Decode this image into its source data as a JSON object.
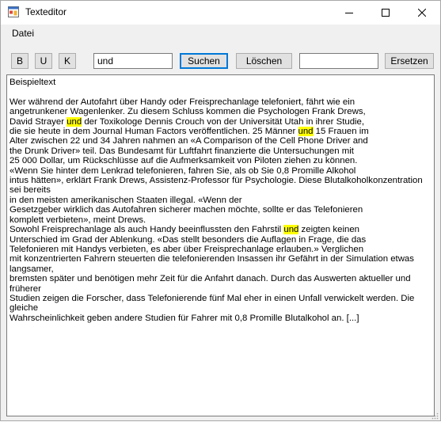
{
  "window": {
    "title": "Texteditor",
    "icons": {
      "app": "window-app-icon",
      "minimize": "minimize-icon",
      "maximize": "maximize-icon",
      "close": "close-icon"
    }
  },
  "menu": {
    "items": [
      {
        "label": "Datei"
      }
    ]
  },
  "toolbar": {
    "bold_label": "B",
    "underline_label": "U",
    "italic_label": "K",
    "search_value": "und",
    "search_button_label": "Suchen",
    "delete_button_label": "Löschen",
    "replace_value": "",
    "replace_button_label": "Ersetzen"
  },
  "editor": {
    "highlight_color": "#ffff00",
    "segments": [
      {
        "text": "Beispieltext\n\nWer während der Autofahrt über Handy oder Freisprechanlage telefoniert, fährt wie ein\nangetrunkener Wagenlenker. Zu diesem Schluss kommen die Psychologen Frank Drews,\nDavid Strayer ",
        "highlight": false
      },
      {
        "text": "und",
        "highlight": true
      },
      {
        "text": " der Toxikologe Dennis Crouch von der Universität Utah in ihrer Studie,\ndie sie heute in dem Journal Human Factors veröffentlichen. 25 Männer ",
        "highlight": false
      },
      {
        "text": "und",
        "highlight": true
      },
      {
        "text": " 15 Frauen im\nAlter zwischen 22 und 34 Jahren nahmen an «A Comparison of the Cell Phone Driver and\nthe Drunk Driver» teil. Das Bundesamt für Luftfahrt finanzierte die Untersuchungen mit\n25 000 Dollar, um Rückschlüsse auf die Aufmerksamkeit von Piloten ziehen zu können.\n«Wenn Sie hinter dem Lenkrad telefonieren, fahren Sie, als ob Sie 0,8 Promille Alkohol\nintus hätten», erklärt Frank Drews, Assistenz-Professor für Psychologie. Diese Blutalkoholkonzentration sei bereits\nin den meisten amerikanischen Staaten illegal. «Wenn der\nGesetzgeber wirklich das Autofahren sicherer machen möchte, sollte er das Telefonieren\nkomplett verbieten», meint Drews.\nSowohl Freisprechanlage als auch Handy beeinflussten den Fahrstil ",
        "highlight": false
      },
      {
        "text": "und",
        "highlight": true
      },
      {
        "text": " zeigten keinen\nUnterschied im Grad der Ablenkung. «Das stellt besonders die Auflagen in Frage, die das\nTelefonieren mit Handys verbieten, es aber über Freisprechanlage erlauben.» Verglichen\nmit konzentrierten Fahrern steuerten die telefonierenden Insassen ihr Gefährt in der Simulation etwas langsamer,\nbremsten später und benötigen mehr Zeit für die Anfahrt danach. Durch das Auswerten aktueller und früherer\nStudien zeigen die Forscher, dass Telefonierende fünf Mal eher in einen Unfall verwickelt werden. Die gleiche\nWahrscheinlichkeit geben andere Studien für Fahrer mit 0,8 Promille Blutalkohol an. [...]",
        "highlight": false
      }
    ]
  }
}
